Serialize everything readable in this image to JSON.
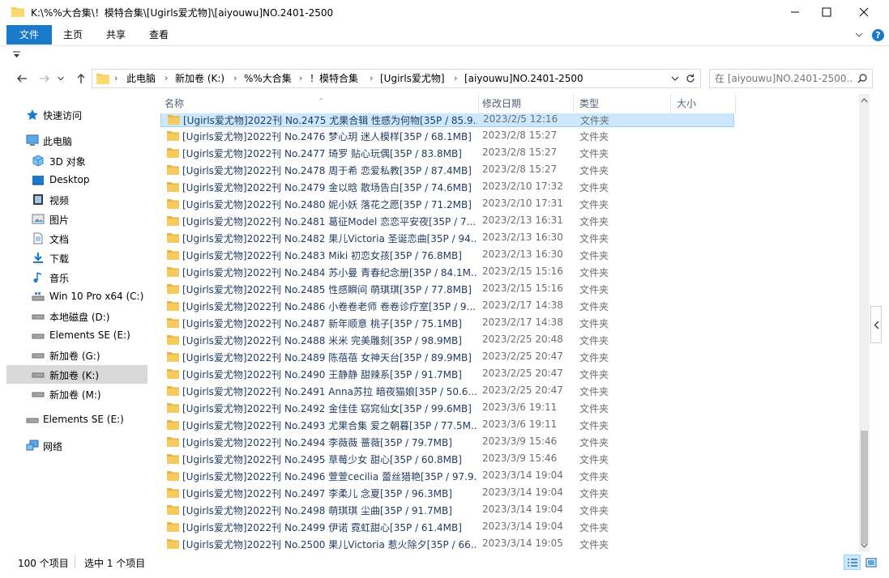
{
  "window": {
    "title": "K:\\%%大合集\\！模特合集\\[Ugirls爱尤物]\\[aiyouwu]NO.2401-2500",
    "minimize_icon": "minimize-icon",
    "maximize_icon": "maximize-icon",
    "close_icon": "close-icon"
  },
  "ribbon": {
    "tabs": [
      "文件",
      "主页",
      "共享",
      "查看"
    ],
    "accent": "#1979ca",
    "help_label": "?"
  },
  "address": {
    "crumbs": [
      "此电脑",
      "新加卷 (K:)",
      "%%大合集",
      "！模特合集",
      "[Ugirls爱尤物]",
      "[aiyouwu]NO.2401-2500"
    ],
    "search_placeholder": "在 [aiyouwu]NO.2401-2500..."
  },
  "nav": {
    "items": [
      {
        "label": "快速访问",
        "icon": "star-icon"
      },
      {
        "label": "此电脑",
        "icon": "computer-icon"
      },
      {
        "label": "3D 对象",
        "icon": "cube-icon"
      },
      {
        "label": "Desktop",
        "icon": "desktop-icon"
      },
      {
        "label": "视频",
        "icon": "video-icon"
      },
      {
        "label": "图片",
        "icon": "picture-icon"
      },
      {
        "label": "文档",
        "icon": "document-icon"
      },
      {
        "label": "下载",
        "icon": "download-icon"
      },
      {
        "label": "音乐",
        "icon": "music-icon"
      },
      {
        "label": "Win 10 Pro x64 (C:)",
        "icon": "system-drive-icon"
      },
      {
        "label": "本地磁盘 (D:)",
        "icon": "drive-icon"
      },
      {
        "label": "Elements SE (E:)",
        "icon": "drive-icon"
      },
      {
        "label": "新加卷 (G:)",
        "icon": "drive-icon"
      },
      {
        "label": "新加卷 (K:)",
        "icon": "drive-icon"
      },
      {
        "label": "新加卷 (M:)",
        "icon": "drive-icon"
      },
      {
        "label": "Elements SE (E:)",
        "icon": "drive-icon"
      },
      {
        "label": "网络",
        "icon": "network-icon"
      }
    ],
    "selected_label": "新加卷 (K:)"
  },
  "columns": [
    "名称",
    "修改日期",
    "类型",
    "大小"
  ],
  "rows": [
    {
      "name": "[Ugirls爱尤物]2022刊 No.2475 尤果合辑 性感为何物[35P / 85.9...",
      "date": "2023/2/5 12:16",
      "type": "文件夹"
    },
    {
      "name": "[Ugirls爱尤物]2022刊 No.2476 梦心玥 迷人模样[35P / 68.1MB]",
      "date": "2023/2/8 15:27",
      "type": "文件夹"
    },
    {
      "name": "[Ugirls爱尤物]2022刊 No.2477 琦罗 贴心玩偶[35P / 83.8MB]",
      "date": "2023/2/8 15:27",
      "type": "文件夹"
    },
    {
      "name": "[Ugirls爱尤物]2022刊 No.2478 周于希 恋爱私教[35P / 87.4MB]",
      "date": "2023/2/8 15:27",
      "type": "文件夹"
    },
    {
      "name": "[Ugirls爱尤物]2022刊 No.2479 金以晗 散场告白[35P / 74.6MB]",
      "date": "2023/2/10 17:32",
      "type": "文件夹"
    },
    {
      "name": "[Ugirls爱尤物]2022刊 No.2480 妮小妖 落花之愿[35P / 71.2MB]",
      "date": "2023/2/10 17:31",
      "type": "文件夹"
    },
    {
      "name": "[Ugirls爱尤物]2022刊 No.2481 葛征Model 恋恋平安夜[35P / 7...",
      "date": "2023/2/13 16:31",
      "type": "文件夹"
    },
    {
      "name": "[Ugirls爱尤物]2022刊 No.2482 果儿Victoria 圣诞恋曲[35P / 94...",
      "date": "2023/2/13 16:30",
      "type": "文件夹"
    },
    {
      "name": "[Ugirls爱尤物]2022刊 No.2483 Miki 初恋女孩[35P / 76.8MB]",
      "date": "2023/2/13 16:30",
      "type": "文件夹"
    },
    {
      "name": "[Ugirls爱尤物]2022刊 No.2484 苏小曼 青春纪念册[35P / 84.1M...",
      "date": "2023/2/15 15:16",
      "type": "文件夹"
    },
    {
      "name": "[Ugirls爱尤物]2022刊 No.2485 性感瞬间 萌琪琪[35P / 77.8MB]",
      "date": "2023/2/15 15:16",
      "type": "文件夹"
    },
    {
      "name": "[Ugirls爱尤物]2022刊 No.2486 小卷卷老师 卷卷诊疗室[35P / 9...",
      "date": "2023/2/17 14:38",
      "type": "文件夹"
    },
    {
      "name": "[Ugirls爱尤物]2022刊 No.2487 新年顺意 桃子[35P / 75.1MB]",
      "date": "2023/2/17 14:38",
      "type": "文件夹"
    },
    {
      "name": "[Ugirls爱尤物]2022刊 No.2488 米米 完美雕刻[35P / 98.9MB]",
      "date": "2023/2/25 20:48",
      "type": "文件夹"
    },
    {
      "name": "[Ugirls爱尤物]2022刊 No.2489 陈蓓蓓 女神天台[35P / 89.9MB]",
      "date": "2023/2/25 20:47",
      "type": "文件夹"
    },
    {
      "name": "[Ugirls爱尤物]2022刊 No.2490 王静静 甜辣系[35P / 91.7MB]",
      "date": "2023/2/25 20:47",
      "type": "文件夹"
    },
    {
      "name": "[Ugirls爱尤物]2022刊 No.2491 Anna苏拉 暗夜猫娘[35P / 50.6...",
      "date": "2023/2/25 20:47",
      "type": "文件夹"
    },
    {
      "name": "[Ugirls爱尤物]2022刊 No.2492 金佳佳 窈窕仙女[35P / 99.6MB]",
      "date": "2023/3/6 19:11",
      "type": "文件夹"
    },
    {
      "name": "[Ugirls爱尤物]2022刊 No.2493 尤果合集 爱之朝暮[35P / 77.5M...",
      "date": "2023/3/6 19:11",
      "type": "文件夹"
    },
    {
      "name": "[Ugirls爱尤物]2022刊 No.2494 李薇薇 蔷薇[35P / 79.7MB]",
      "date": "2023/3/9 15:46",
      "type": "文件夹"
    },
    {
      "name": "[Ugirls爱尤物]2022刊 No.2495 草莓少女 甜心[35P / 60.8MB]",
      "date": "2023/3/9 15:46",
      "type": "文件夹"
    },
    {
      "name": "[Ugirls爱尤物]2022刊 No.2496 萱萱cecilia 蕾丝猎艳[35P / 97.9...",
      "date": "2023/3/14 19:04",
      "type": "文件夹"
    },
    {
      "name": "[Ugirls爱尤物]2022刊 No.2497 李柔儿 念夏[35P / 96.3MB]",
      "date": "2023/3/14 19:04",
      "type": "文件夹"
    },
    {
      "name": "[Ugirls爱尤物]2022刊 No.2498 萌琪琪 尘曲[35P / 91.7MB]",
      "date": "2023/3/14 19:04",
      "type": "文件夹"
    },
    {
      "name": "[Ugirls爱尤物]2022刊 No.2499 伊诺 霓虹甜心[35P / 61.4MB]",
      "date": "2023/3/14 19:04",
      "type": "文件夹"
    },
    {
      "name": "[Ugirls爱尤物]2022刊 No.2500 果儿Victoria 惹火除夕[35P / 66...",
      "date": "2023/3/14 19:05",
      "type": "文件夹"
    }
  ],
  "status": {
    "item_count": "100 个项目",
    "selected": "选中 1 个项目"
  },
  "colors": {
    "folder": "#f6ca5e",
    "selection": "#cce8ff",
    "nav_selected": "#d9d9d9"
  }
}
